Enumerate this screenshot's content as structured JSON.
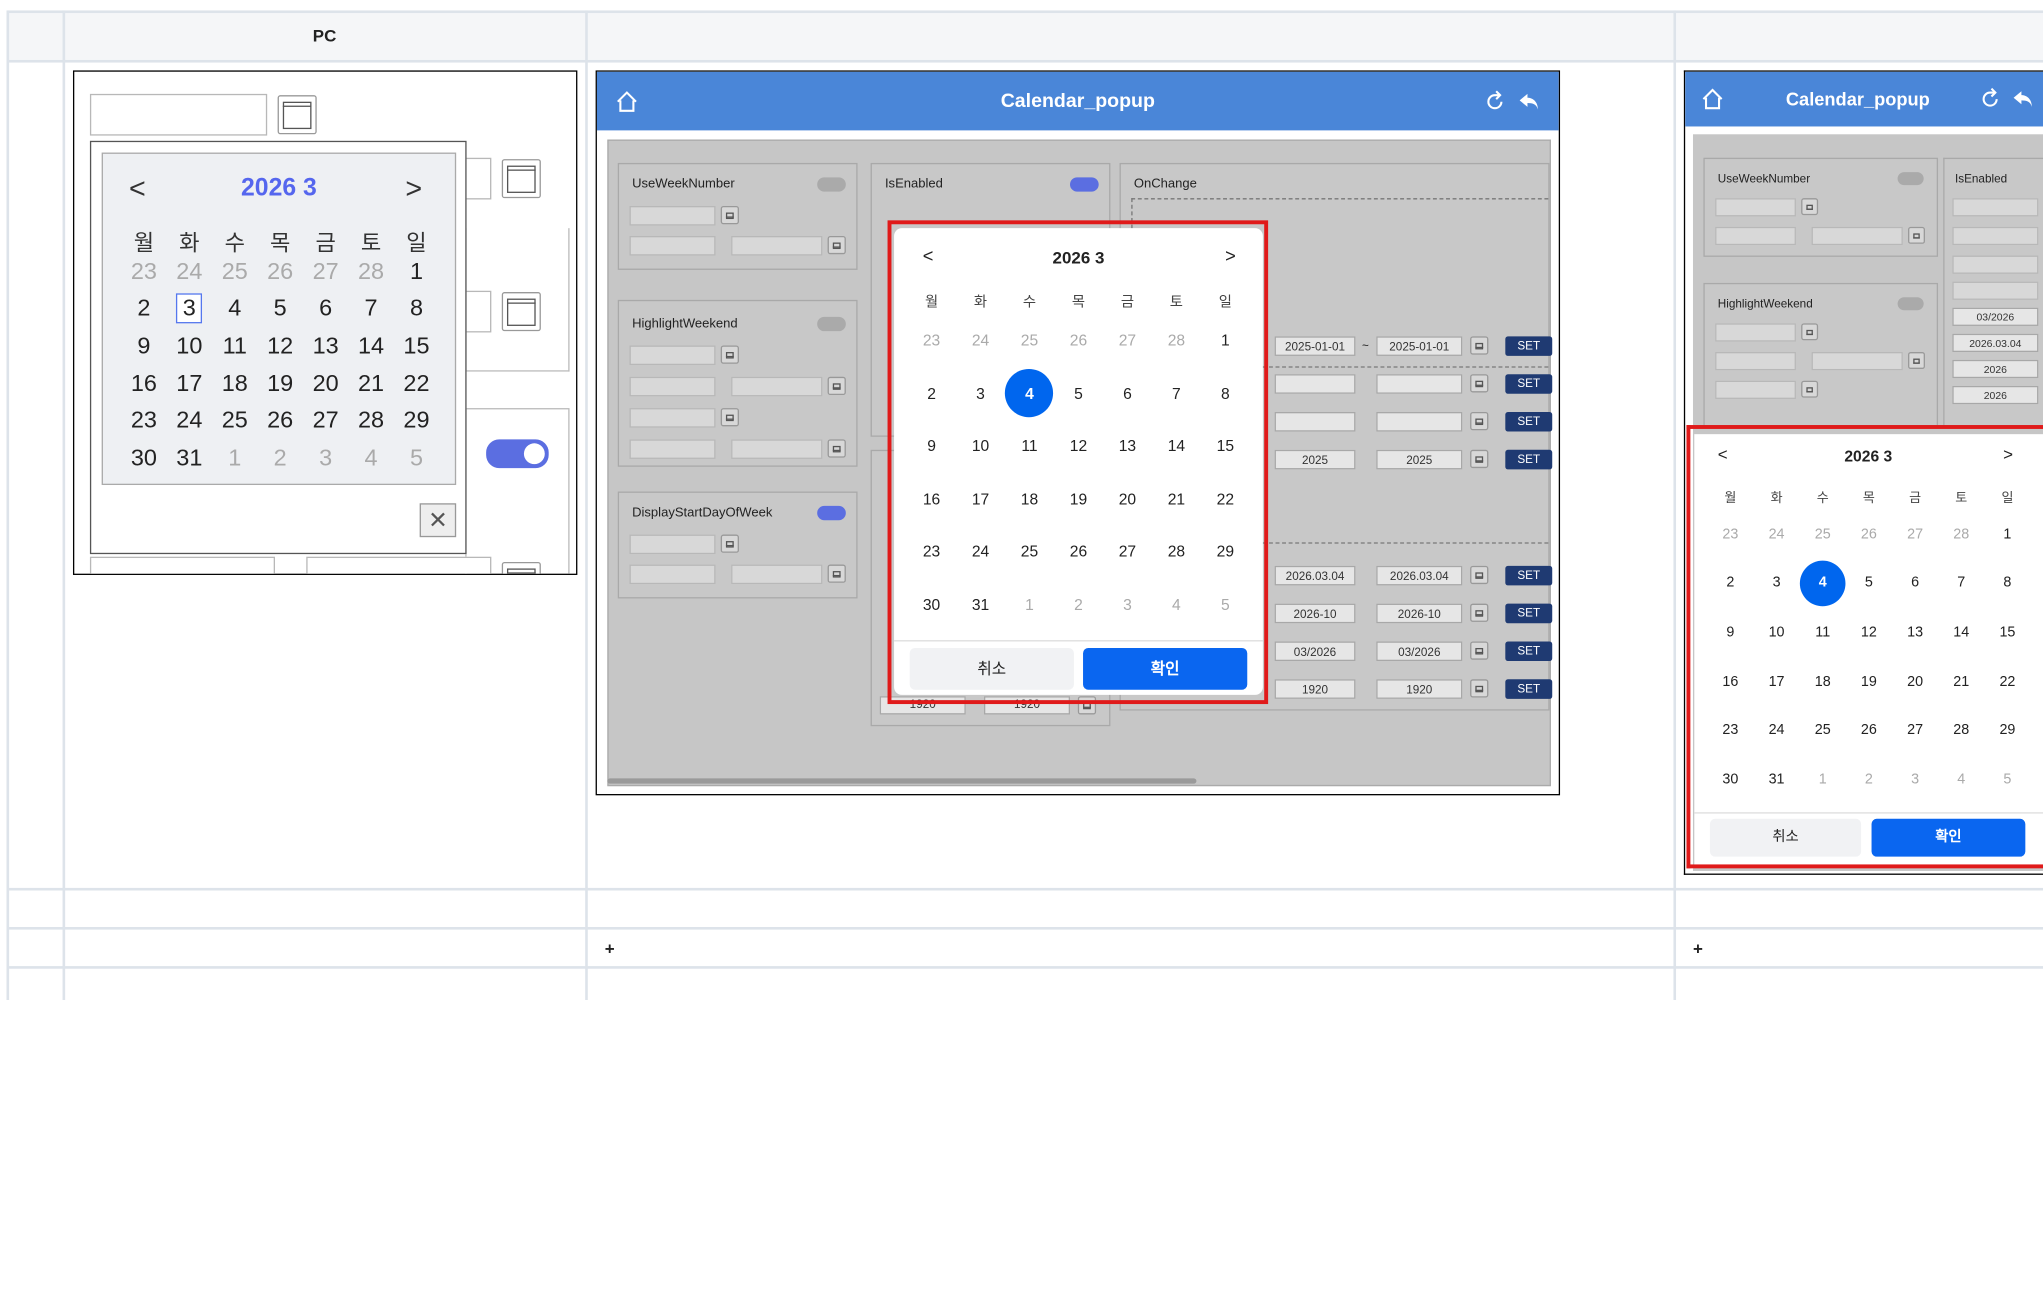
{
  "table": {
    "col1_header": "PC",
    "col2_header": "",
    "col3_header": "",
    "plus1": "+",
    "plus2": "+"
  },
  "pc": {
    "nav_prev": "<",
    "nav_next": ">",
    "title": "2026 3",
    "weekdays": [
      "월",
      "화",
      "수",
      "목",
      "금",
      "토",
      "일"
    ],
    "weeks": [
      [
        "23",
        "24",
        "25",
        "26",
        "27",
        "28",
        "1"
      ],
      [
        "2",
        "3",
        "4",
        "5",
        "6",
        "7",
        "8"
      ],
      [
        "9",
        "10",
        "11",
        "12",
        "13",
        "14",
        "15"
      ],
      [
        "16",
        "17",
        "18",
        "19",
        "20",
        "21",
        "22"
      ],
      [
        "23",
        "24",
        "25",
        "26",
        "27",
        "28",
        "29"
      ],
      [
        "30",
        "31",
        "1",
        "2",
        "3",
        "4",
        "5"
      ]
    ],
    "today": "3",
    "close": "✕"
  },
  "mid": {
    "app_title": "Calendar_popup",
    "labels": {
      "week": "UseWeekNumber",
      "enabled": "IsEnabled",
      "onchange": "OnChange",
      "highlight": "HighlightWeekend",
      "display": "DisplayStartDayOfWeek"
    },
    "values": {
      "r1a": "2025-01-01",
      "r1b": "2025-01-01",
      "r4a": "2025",
      "r4b": "2025",
      "r5a": "2026.03.04",
      "r5b": "2026.03.04",
      "r6a": "2026-10",
      "r6b": "2026-10",
      "r7a": "03/2026",
      "r7b": "03/2026",
      "r8a": "1920",
      "r8b": "1920",
      "bl": "1920",
      "br": "1920",
      "tilde": "~"
    },
    "set": "SET",
    "popup": {
      "title": "2026 3",
      "prev": "<",
      "next": ">",
      "selected": "4",
      "cancel": "취소",
      "ok": "확인"
    }
  },
  "right": {
    "app_title": "Calendar_popup",
    "labels": {
      "week": "UseWeekNumber",
      "enabled": "IsEnabled",
      "highlight": "HighlightWeekend"
    },
    "values": {
      "a": "03/2026",
      "b": "2026.03.04",
      "c": "2026",
      "d": "2026",
      "tilde": "~"
    },
    "popup": {
      "title": "2026 3",
      "prev": "<",
      "next": ">",
      "selected": "4",
      "cancel": "취소",
      "ok": "확인"
    }
  },
  "colors": {
    "accent": "#4a86d8",
    "selected": "#0066ee",
    "highlight": "#e01a1a",
    "toggle_on": "#5b6ee1"
  }
}
